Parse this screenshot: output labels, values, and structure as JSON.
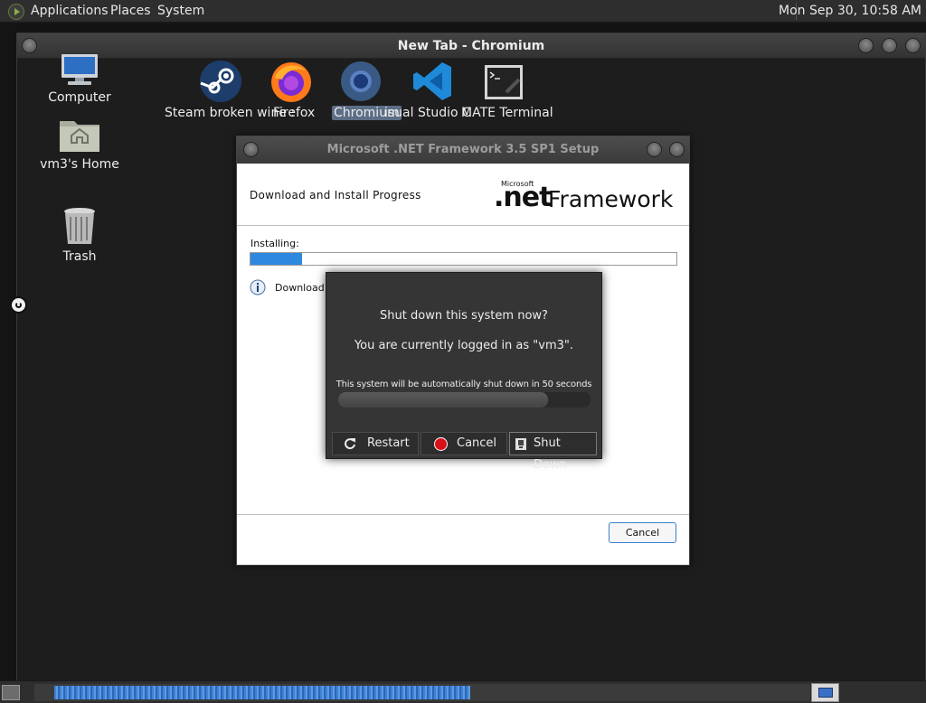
{
  "top_panel": {
    "menus": [
      "Applications",
      "Places",
      "System"
    ],
    "clock": "Mon Sep 30, 10:58 AM"
  },
  "window": {
    "title": "New Tab - Chromium"
  },
  "desktop": {
    "icons": [
      {
        "label": "Computer",
        "icon": "computer-icon"
      },
      {
        "label": "vm3's Home",
        "icon": "home-folder-icon"
      },
      {
        "label": "Trash",
        "icon": "trash-icon"
      }
    ],
    "launchers": [
      {
        "label": "Steam broken wine :",
        "icon": "steam-icon"
      },
      {
        "label": "Firefox",
        "icon": "firefox-icon"
      },
      {
        "label": "Chromium",
        "icon": "chromium-icon"
      },
      {
        "label": "isual Studio C",
        "icon": "vscode-icon"
      },
      {
        "label": "MATE Terminal",
        "icon": "terminal-icon"
      }
    ]
  },
  "net_dialog": {
    "title": "Microsoft .NET Framework 3.5 SP1 Setup",
    "header": "Download and Install Progress",
    "logo": {
      "microsoft": "Microsoft",
      "net": ".net",
      "framework": "Framework"
    },
    "installing_label": "Installing:",
    "progress_fraction": 0.12,
    "download_text": "Download",
    "cancel_label": "Cancel"
  },
  "shutdown_dialog": {
    "question": "Shut down this system now?",
    "logged_in": "You are currently logged in as \"vm3\".",
    "auto_text": "This system will be automatically shut down in 50 seconds",
    "countdown_fraction": 0.83,
    "buttons": {
      "restart": "Restart",
      "cancel": "Cancel",
      "shutdown": "Shut Down"
    }
  },
  "colors": {
    "accent_blue": "#2f88e0",
    "panel_bg": "#2e2e2e",
    "desktop_bg": "#1d1d1d"
  }
}
